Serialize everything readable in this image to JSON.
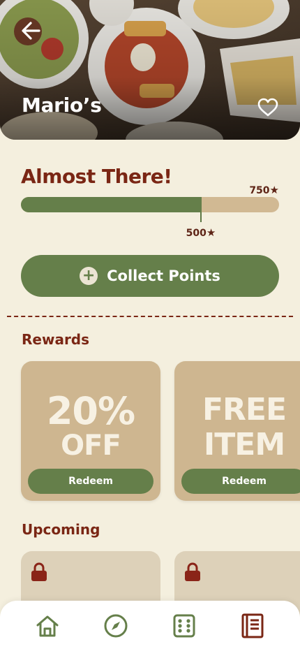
{
  "header": {
    "title": "Mario’s",
    "back_icon": "arrow-left-icon",
    "favorite_icon": "heart-outline-icon"
  },
  "progress": {
    "title": "Almost There!",
    "current_points": 500,
    "current_label": "500",
    "goal_points": 750,
    "goal_label": "750",
    "fill_fraction": 0.7
  },
  "collect_button": {
    "label": "Collect Points",
    "icon": "plus-circle-icon"
  },
  "rewards": {
    "title": "Rewards",
    "items": [
      {
        "line1": "20%",
        "line2": "OFF",
        "button_label": "Redeem"
      },
      {
        "line1": "FREE",
        "line2": "ITEM",
        "button_label": "Redeem"
      }
    ]
  },
  "upcoming": {
    "title": "Upcoming",
    "items": [
      {
        "icon": "lock-icon"
      },
      {
        "icon": "lock-icon"
      }
    ]
  },
  "bottom_nav": {
    "items": [
      {
        "icon": "home-icon"
      },
      {
        "icon": "compass-icon"
      },
      {
        "icon": "dice-icon"
      },
      {
        "icon": "menu-book-icon"
      }
    ]
  },
  "colors": {
    "background": "#f4efde",
    "brand_green": "#657f4a",
    "brand_red": "#7a2614",
    "card_tan": "#ceb690"
  }
}
